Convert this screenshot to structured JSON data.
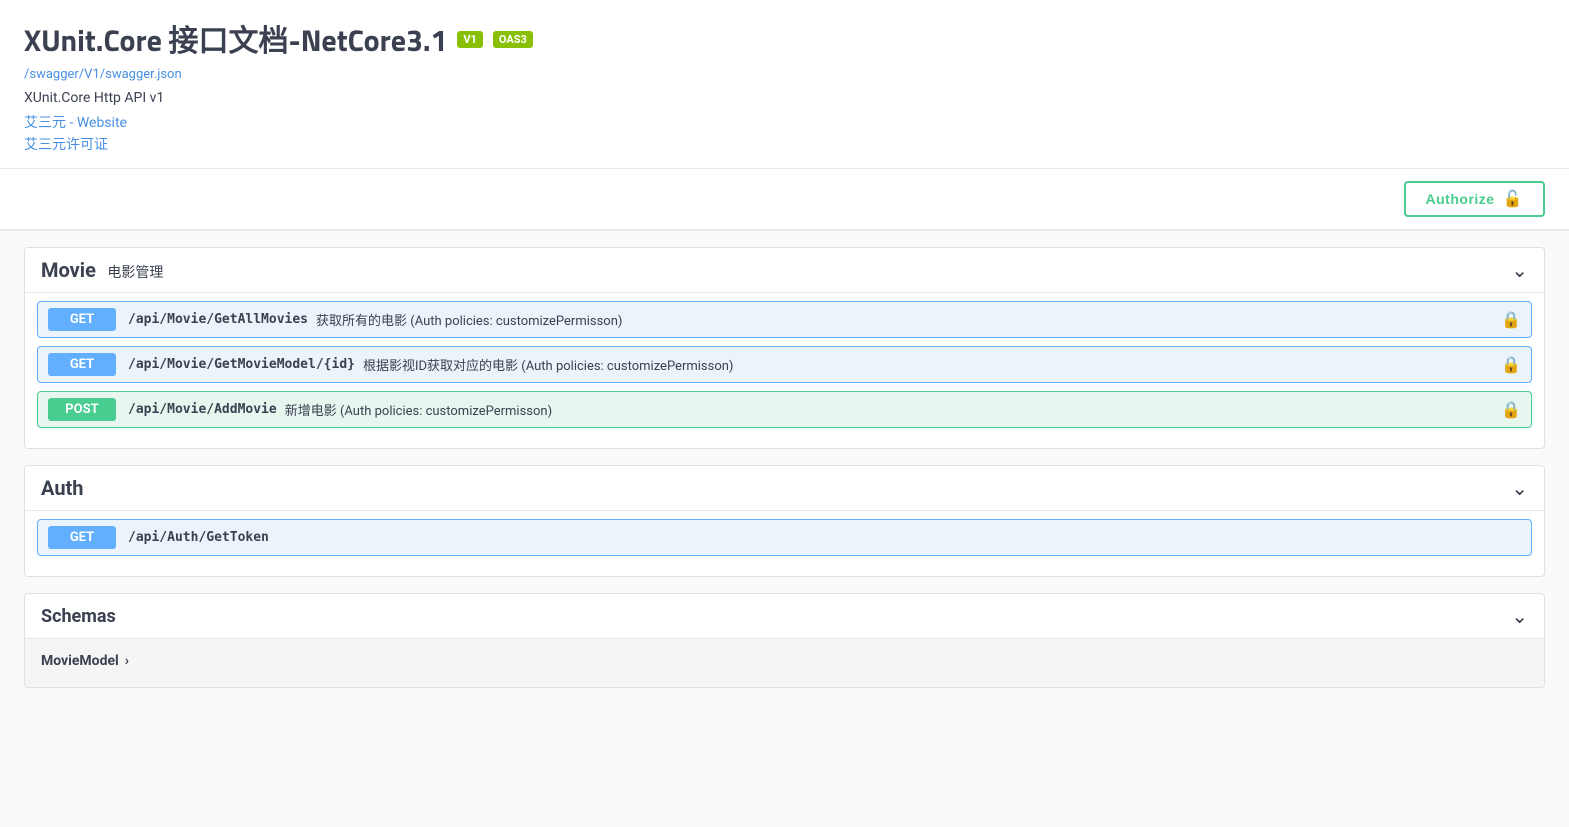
{
  "header": {
    "title": "XUnit.Core 接口文档-NetCore3.1",
    "badge_v1": "V1",
    "badge_oas3": "OAS3",
    "swagger_url": "/swagger/V1/swagger.json",
    "description": "XUnit.Core Http API v1",
    "contact_name": "艾三元 - Website",
    "contact_license": "艾三元许可证",
    "authorize_label": "Authorize",
    "lock_icon": "🔓"
  },
  "sections": [
    {
      "id": "movie",
      "title": "Movie",
      "subtitle": "电影管理",
      "endpoints": [
        {
          "method": "GET",
          "path": "/api/Movie/GetAllMovies",
          "description": "获取所有的电影 (Auth policies: customizePermisson)",
          "locked": true
        },
        {
          "method": "GET",
          "path": "/api/Movie/GetMovieModel/{id}",
          "description": "根据影视ID获取对应的电影 (Auth policies: customizePermisson)",
          "locked": true
        },
        {
          "method": "POST",
          "path": "/api/Movie/AddMovie",
          "description": "新增电影 (Auth policies: customizePermisson)",
          "locked": true
        }
      ]
    },
    {
      "id": "auth",
      "title": "Auth",
      "subtitle": "",
      "endpoints": [
        {
          "method": "GET",
          "path": "/api/Auth/GetToken",
          "description": "",
          "locked": false
        }
      ]
    }
  ],
  "schemas": {
    "title": "Schemas",
    "items": [
      {
        "name": "MovieModel"
      }
    ]
  }
}
